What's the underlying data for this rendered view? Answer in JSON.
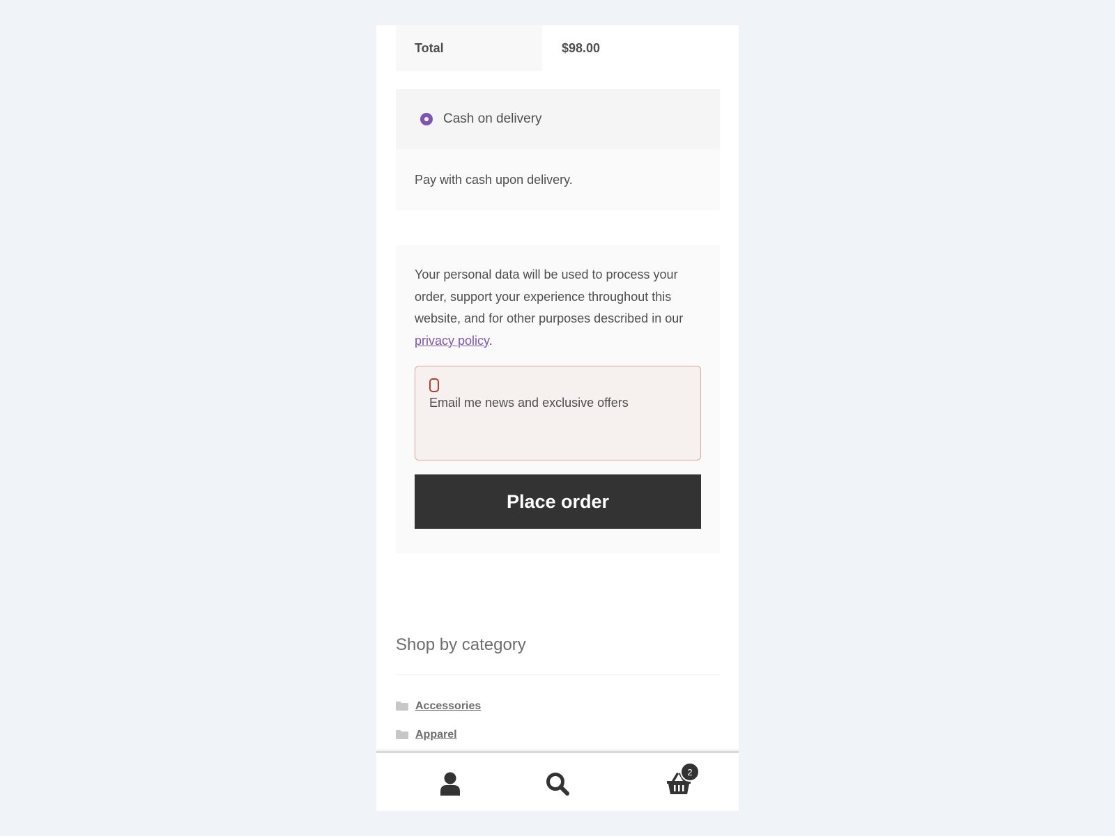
{
  "order_totals": {
    "total_label": "Total",
    "total_value": "$98.00"
  },
  "payment": {
    "method_label": "Cash on delivery",
    "method_selected": true,
    "description": "Pay with cash upon delivery."
  },
  "privacy": {
    "text_before": "Your personal data will be used to process your order, support your experience throughout this website, and for other purposes described in our ",
    "link_label": "privacy policy",
    "text_after": "."
  },
  "newsletter": {
    "label": "Email me news and exclusive offers",
    "checked": false
  },
  "place_order": {
    "label": "Place order"
  },
  "categories_widget": {
    "title": "Shop by category",
    "items": [
      {
        "label": "Accessories"
      },
      {
        "label": "Apparel"
      }
    ]
  },
  "footer_bar": {
    "account_icon": "user-icon",
    "search_icon": "search-icon",
    "cart_icon": "basket-icon",
    "cart_count": "2"
  },
  "colors": {
    "accent": "#7f54b3",
    "button_bg": "#333333",
    "error_border": "#e4a69b",
    "page_bg": "#f0f3f8"
  }
}
